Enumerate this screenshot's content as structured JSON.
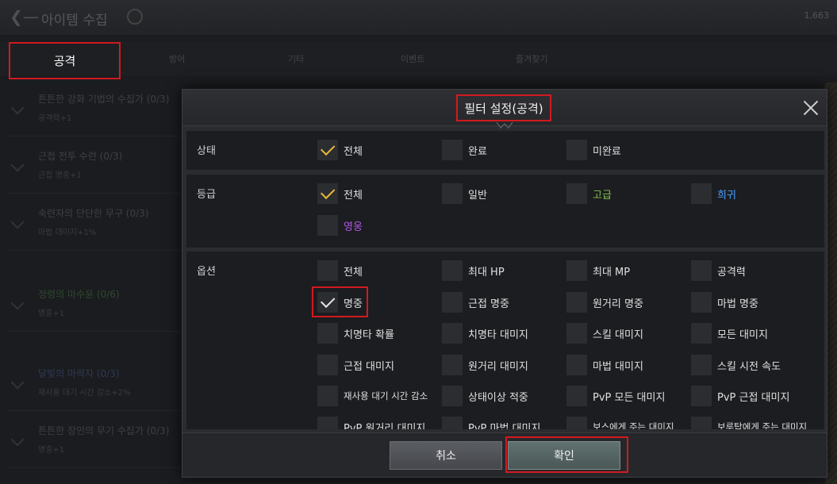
{
  "background": {
    "title": "아이템 수집",
    "currency": "1,663",
    "tabs": [
      "공격",
      "방어",
      "기타",
      "이벤트",
      "즐겨찾기"
    ],
    "list": [
      {
        "title": "튼튼한 강화 기법의 수집가 (0/3)",
        "sub": "공격력+1",
        "tone": "normal"
      },
      {
        "title": "근접 전투 수련 (0/3)",
        "sub": "근접 명중+1",
        "tone": "normal"
      },
      {
        "title": "숙련자의 단단한 무구 (0/3)",
        "sub": "마법 대미지+1%",
        "tone": "normal"
      },
      {
        "title": "정령의 마수윤 (0/6)",
        "sub": "명중+1",
        "tone": "green"
      },
      {
        "title": "달빛의 마력자 (0/3)",
        "sub": "재사용 대기 시간 감소+2%",
        "tone": "blue"
      },
      {
        "title": "튼튼한 장인의 무기 수집가 (0/3)",
        "sub": "명중+1",
        "tone": "normal"
      }
    ]
  },
  "modal": {
    "title": "필터 설정(공격)",
    "sections": {
      "status": {
        "label": "상태",
        "options": [
          {
            "label": "전체",
            "checked": true,
            "color": "normal"
          },
          {
            "label": "완료",
            "checked": false,
            "color": "normal"
          },
          {
            "label": "미완료",
            "checked": false,
            "color": "normal"
          }
        ]
      },
      "grade": {
        "label": "등급",
        "options": [
          {
            "label": "전체",
            "checked": true,
            "color": "normal"
          },
          {
            "label": "일반",
            "checked": false,
            "color": "normal"
          },
          {
            "label": "고급",
            "checked": false,
            "color": "green"
          },
          {
            "label": "희귀",
            "checked": false,
            "color": "blue"
          },
          {
            "label": "영웅",
            "checked": false,
            "color": "purple"
          }
        ]
      },
      "option": {
        "label": "옵션",
        "options": [
          {
            "label": "전체",
            "checked": false
          },
          {
            "label": "최대 HP",
            "checked": false
          },
          {
            "label": "최대 MP",
            "checked": false
          },
          {
            "label": "공격력",
            "checked": false
          },
          {
            "label": "명중",
            "checked": true
          },
          {
            "label": "근접 명중",
            "checked": false
          },
          {
            "label": "원거리 명중",
            "checked": false
          },
          {
            "label": "마법 명중",
            "checked": false
          },
          {
            "label": "치명타 확률",
            "checked": false
          },
          {
            "label": "치명타 대미지",
            "checked": false
          },
          {
            "label": "스킬 대미지",
            "checked": false
          },
          {
            "label": "모든 대미지",
            "checked": false
          },
          {
            "label": "근접 대미지",
            "checked": false
          },
          {
            "label": "원거리 대미지",
            "checked": false
          },
          {
            "label": "마법 대미지",
            "checked": false
          },
          {
            "label": "스킬 시전 속도",
            "checked": false
          },
          {
            "label": "재사용 대기 시간 감소",
            "checked": false
          },
          {
            "label": "상태이상 적중",
            "checked": false
          },
          {
            "label": "PvP 모든 대미지",
            "checked": false
          },
          {
            "label": "PvP 근접 대미지",
            "checked": false
          },
          {
            "label": "PvP 원거리 대미지",
            "checked": false
          },
          {
            "label": "PvP 마법 대미지",
            "checked": false
          },
          {
            "label": "보스에게 주는 대미지",
            "checked": false
          },
          {
            "label": "보루탑에게 주는 대미지",
            "checked": false
          }
        ]
      }
    },
    "buttons": {
      "cancel": "취소",
      "confirm": "확인"
    }
  },
  "colors": {
    "check_gold": "#e8b838",
    "highlight_red": "#d11a1f",
    "grade_green": "#7fc04f",
    "grade_blue": "#4aa0ff",
    "grade_purple": "#b257e8"
  }
}
